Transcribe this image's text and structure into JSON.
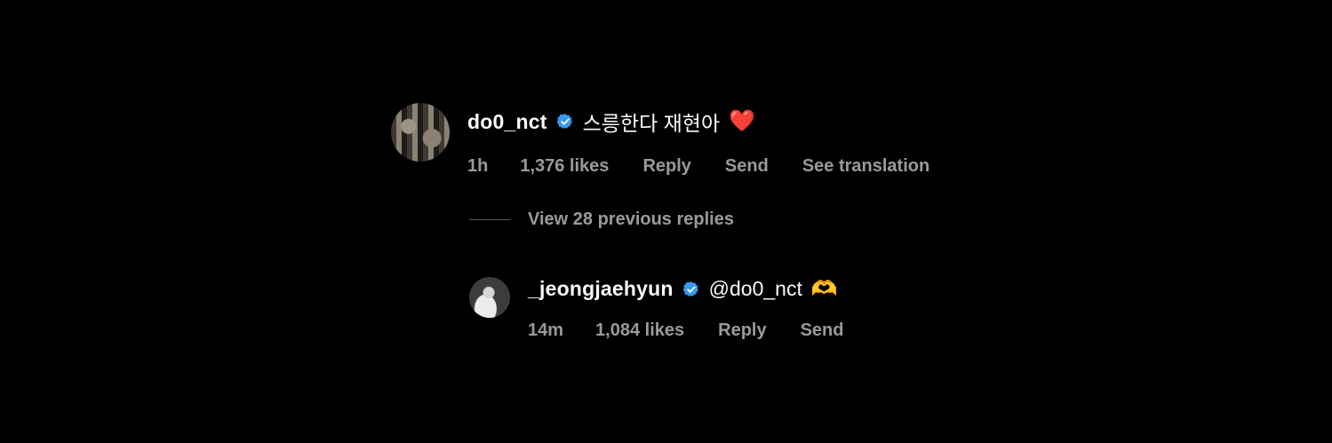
{
  "main_comment": {
    "username": "do0_nct",
    "text": "스릉한다 재현아",
    "emoji": "❤️",
    "time": "1h",
    "likes": "1,376 likes",
    "reply_label": "Reply",
    "send_label": "Send",
    "translate_label": "See translation"
  },
  "view_replies": "View 28 previous replies",
  "reply_comment": {
    "username": "_jeongjaehyun",
    "text": "@do0_nct",
    "emoji": "🫶",
    "time": "14m",
    "likes": "1,084 likes",
    "reply_label": "Reply",
    "send_label": "Send"
  },
  "colors": {
    "background": "#000000",
    "verified": "#3897f0",
    "meta_text": "#9a9a9a",
    "heart": "#e0162b"
  },
  "icons": [
    "verified-badge-icon",
    "heart-emoji",
    "heart-hands-emoji"
  ]
}
